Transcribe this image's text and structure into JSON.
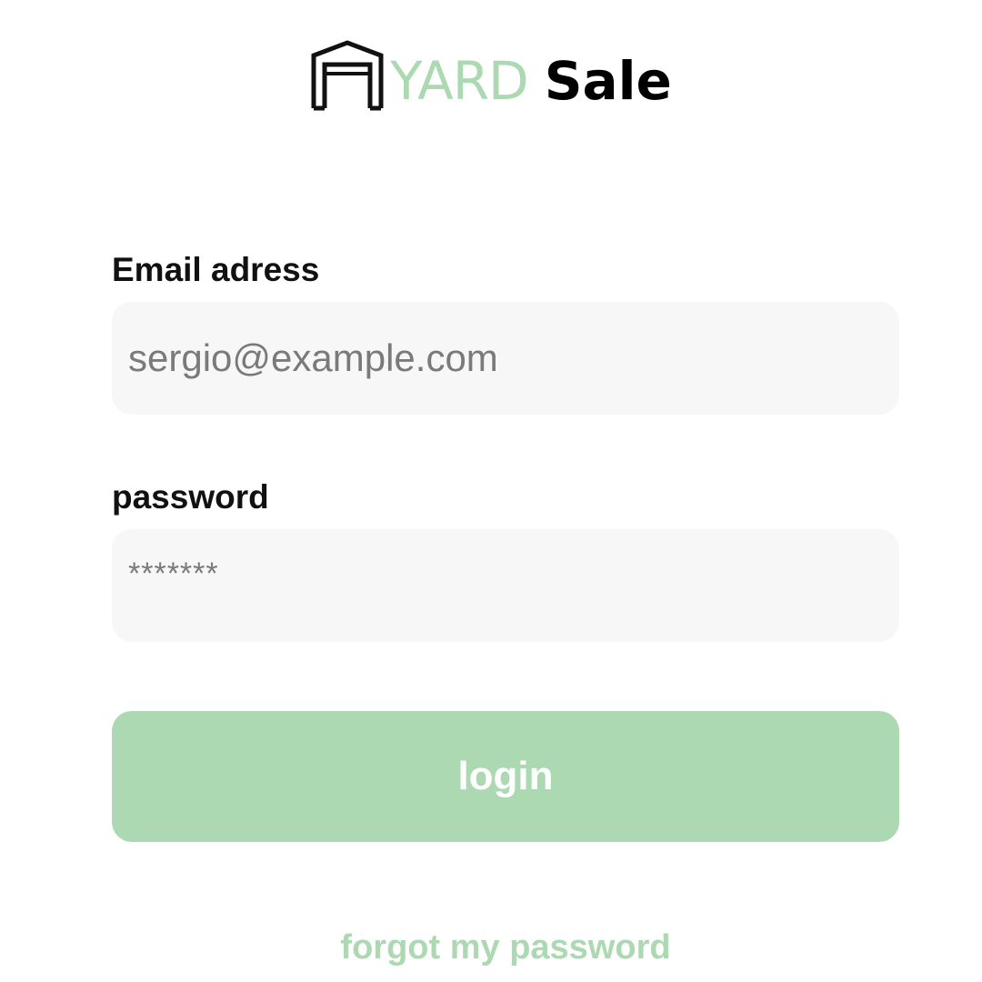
{
  "brand": {
    "name_part1": "YARD",
    "name_part2": "Sale",
    "logo_icon": "garage-door-icon",
    "accent_color": "#acd9b2",
    "text_color": "#000000"
  },
  "form": {
    "email": {
      "label": "Email adress",
      "placeholder": "sergio@example.com"
    },
    "password": {
      "label": "password",
      "placeholder": "*******"
    },
    "login_label": "login",
    "forgot_label": "forgot my password"
  },
  "colors": {
    "input_background": "#f7f7f7",
    "button_background": "#acd9b2",
    "link_color": "#acd9b2",
    "label_color": "#111111",
    "placeholder_color": "#7a7a7a"
  }
}
